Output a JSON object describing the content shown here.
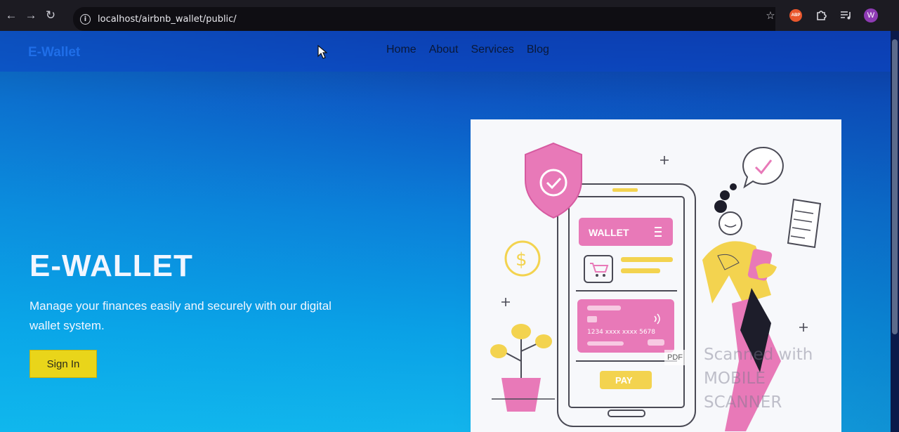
{
  "browser": {
    "url": "localhost/airbnb_wallet/public/",
    "extension_badge": "ABP",
    "profile_initial": "W",
    "icons": [
      "back-arrow-icon",
      "forward-arrow-icon",
      "reload-icon",
      "info-icon",
      "star-icon",
      "extension-icon",
      "puzzle-icon",
      "media-icon",
      "profile-avatar"
    ]
  },
  "site": {
    "brand": "E-Wallet",
    "nav": [
      "Home",
      "About",
      "Services",
      "Blog"
    ],
    "hero": {
      "title": "E-WALLET",
      "subtitle": "Manage your finances easily and securely with our digital wallet system.",
      "button": "Sign In"
    },
    "illustration": {
      "wallet_label": "WALLET",
      "card_number": "1234 xxxx xxxx 5678",
      "pay_label": "PAY"
    }
  },
  "overlay": {
    "watermark_line1": "Scanned with",
    "watermark_line2": "MOBILE SCANNER",
    "pdf_label": "PDF"
  },
  "colors": {
    "brand": "#1f6ee8",
    "button": "#e9d51a",
    "hero_gradient_top": "#0c3a98",
    "hero_gradient_bottom": "#12b5ec",
    "illustration_pink": "#e879b8",
    "illustration_yellow": "#f3d34f"
  }
}
